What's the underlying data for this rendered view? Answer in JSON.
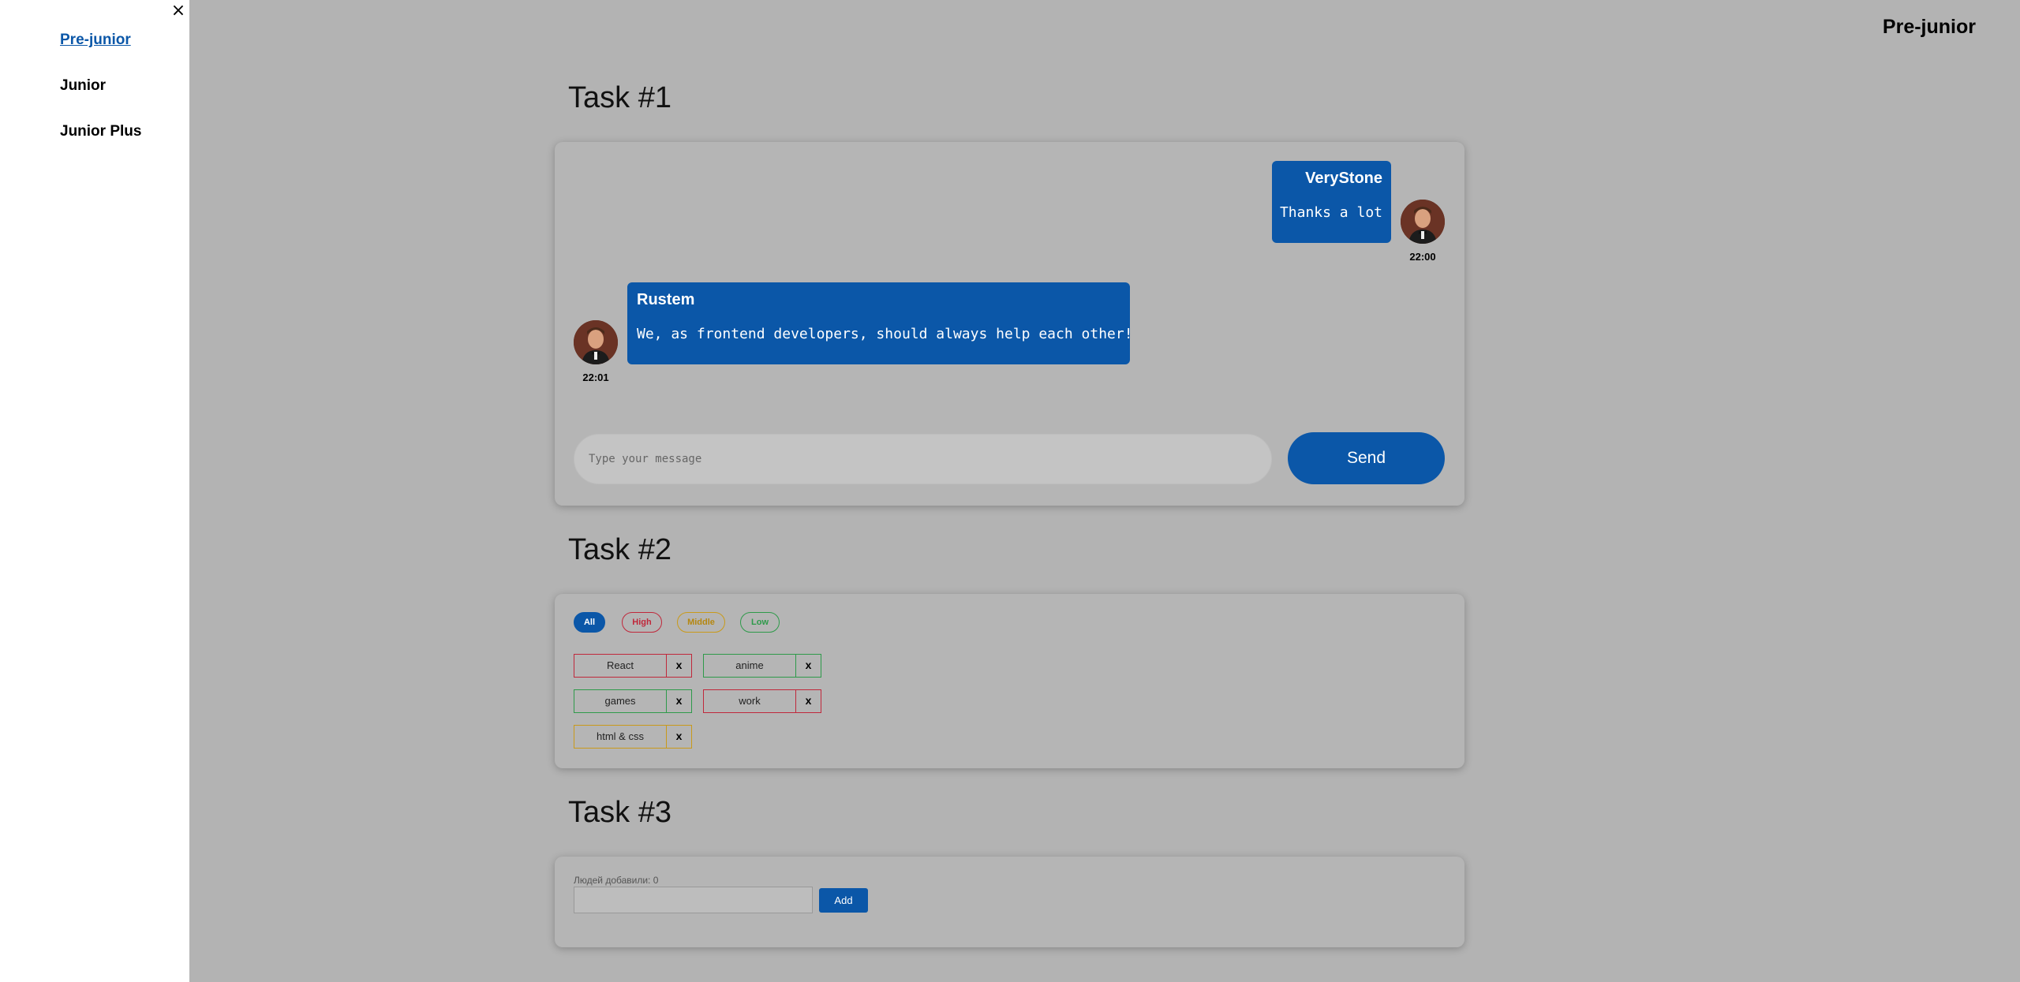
{
  "sidebar": {
    "close_glyph": "×",
    "items": [
      {
        "label": "Pre-junior",
        "active": true
      },
      {
        "label": "Junior",
        "active": false
      },
      {
        "label": "Junior Plus",
        "active": false
      }
    ]
  },
  "header": {
    "title": "Pre-junior"
  },
  "task1": {
    "title": "Task #1",
    "messages": [
      {
        "name": "VeryStone",
        "text": "Thanks a lot",
        "time": "22:00",
        "side": "right"
      },
      {
        "name": "Rustem",
        "text": "We, as frontend developers, should always help each other!",
        "time": "22:01",
        "side": "left"
      }
    ],
    "input_placeholder": "Type your message",
    "send_label": "Send"
  },
  "task2": {
    "title": "Task #2",
    "filters": [
      {
        "label": "All",
        "color": "blue"
      },
      {
        "label": "High",
        "color": "red"
      },
      {
        "label": "Middle",
        "color": "orange"
      },
      {
        "label": "Low",
        "color": "green"
      }
    ],
    "tags": [
      {
        "label": "React",
        "priority": "high"
      },
      {
        "label": "anime",
        "priority": "low"
      },
      {
        "label": "games",
        "priority": "low"
      },
      {
        "label": "work",
        "priority": "high"
      },
      {
        "label": "html & css",
        "priority": "middle"
      }
    ],
    "delete_glyph": "x"
  },
  "task3": {
    "title": "Task #3",
    "count_label": "Людей добавили: 0",
    "add_label": "Add"
  },
  "colors": {
    "accent": "#0b57a8",
    "background": "#b3b3b3",
    "high": "#c0283b",
    "middle": "#c99a1a",
    "low": "#2e9a4a"
  }
}
